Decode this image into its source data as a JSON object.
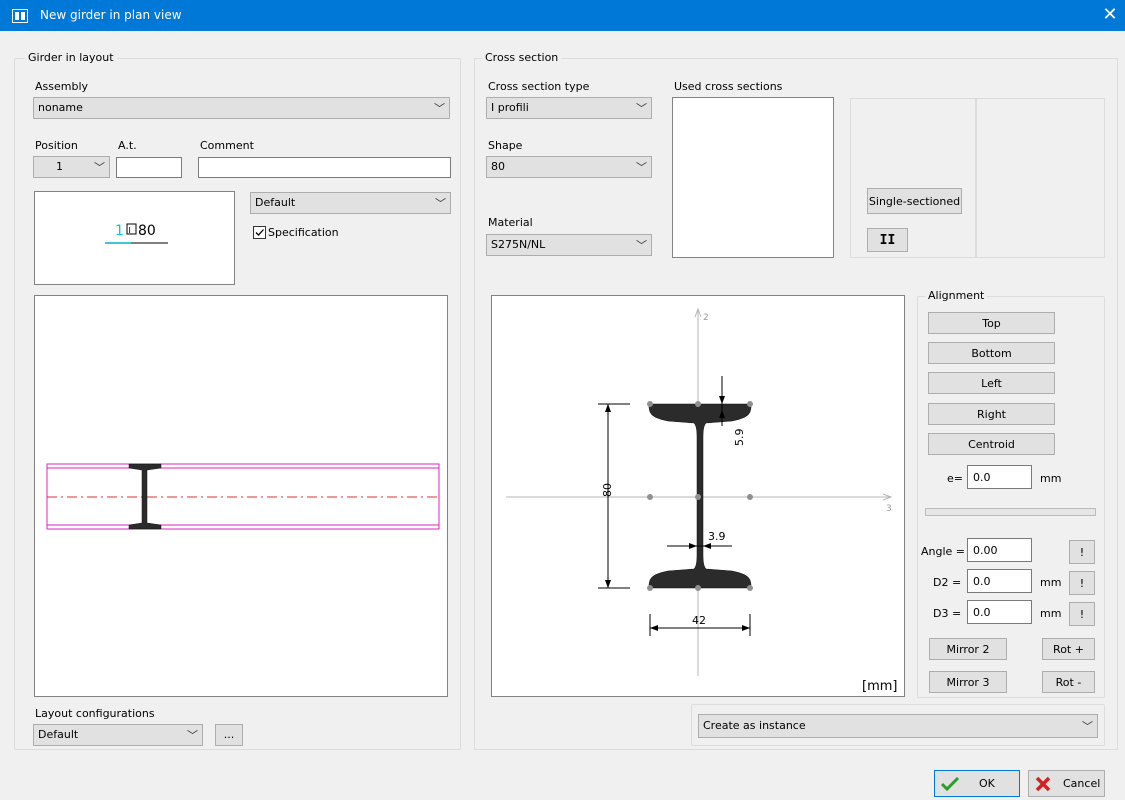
{
  "window": {
    "title": "New girder in plan view"
  },
  "girder_layout": {
    "title": "Girder in layout",
    "assembly_label": "Assembly",
    "assembly_value": "noname",
    "position_label": "Position",
    "position_value": "1",
    "at_label": "A.t.",
    "at_value": "",
    "comment_label": "Comment",
    "comment_value": "",
    "preview_number": "1",
    "preview_profile": "80",
    "style_value": "Default",
    "specification_label": "Specification",
    "specification_checked": true,
    "layout_config_label": "Layout configurations",
    "layout_config_value": "Default",
    "browse_label": "..."
  },
  "cross_section": {
    "title": "Cross section",
    "type_label": "Cross section type",
    "type_value": "I profili",
    "shape_label": "Shape",
    "shape_value": "80",
    "material_label": "Material",
    "material_value": "S275N/NL",
    "used_label": "Used cross sections",
    "single_sectioned_label": "Single-sectioned",
    "double_label": "II",
    "drawing": {
      "axis2": "2",
      "axis3": "3",
      "height": "80",
      "flange_thickness": "5.9",
      "web_thickness": "3.9",
      "width": "42",
      "unit": "[mm]"
    },
    "create_mode_value": "Create as instance"
  },
  "alignment": {
    "title": "Alignment",
    "top": "Top",
    "bottom": "Bottom",
    "left": "Left",
    "right": "Right",
    "centroid": "Centroid",
    "e_label": "e=",
    "e_value": "0.0",
    "e_unit": "mm",
    "angle_label": "Angle =",
    "angle_value": "0.00",
    "d2_label": "D2 =",
    "d2_value": "0.0",
    "d2_unit": "mm",
    "d3_label": "D3 =",
    "d3_value": "0.0",
    "d3_unit": "mm",
    "bang": "!",
    "mirror2": "Mirror 2",
    "mirror3": "Mirror 3",
    "rot_plus": "Rot +",
    "rot_minus": "Rot -"
  },
  "footer": {
    "ok": "OK",
    "cancel": "Cancel"
  },
  "colors": {
    "titlebar": "#0078d7",
    "accent_cyan": "#00c8e0",
    "pink": "#e020c0",
    "red": "#e03030"
  }
}
